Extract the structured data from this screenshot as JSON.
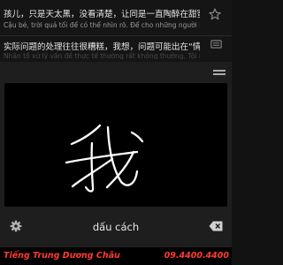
{
  "results": [
    {
      "zh": "孩儿，只是天太黑，没看清楚，让同是一直陶醉在甜蜜...",
      "vi": "Cậu bé, trời quá tối để có thể nhìn rõ. Để cho những người b..."
    },
    {
      "zh": "实际问题的处理往往很糟糕，我想，问题可能出在“情商...",
      "vi": "Nhân tố xử lý vấn đề thực tế thường rất không thường. Tôi ng..."
    }
  ],
  "icons": {
    "star": "star-icon",
    "copy": "copy-icon",
    "handle": "drag-handle-icon",
    "settings": "gear-icon",
    "backspace": "backspace-icon"
  },
  "keyboard": {
    "space_label": "dấu cách",
    "handwriting_char": "我"
  },
  "footer": {
    "brand": "Tiếng Trung Dương Châu",
    "phone": "09.4400.4400"
  },
  "colors": {
    "background": "#121212",
    "canvas": "#000000",
    "ink": "#ffffff",
    "footer_text": "#ff3b30"
  }
}
